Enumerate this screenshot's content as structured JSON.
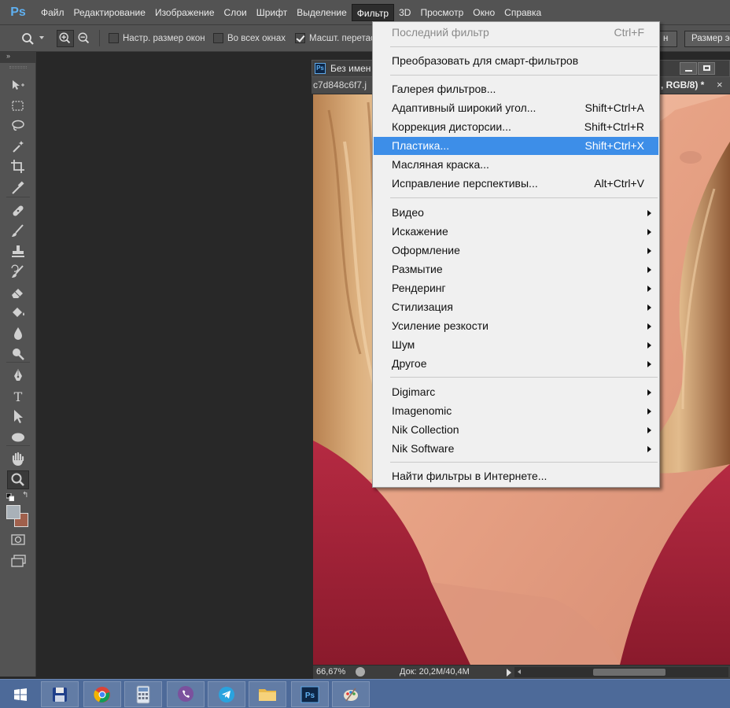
{
  "app": {
    "logo_text": "Ps"
  },
  "menubar": {
    "items": [
      "Файл",
      "Редактирование",
      "Изображение",
      "Слои",
      "Шрифт",
      "Выделение",
      "Фильтр",
      "3D",
      "Просмотр",
      "Окно",
      "Справка"
    ],
    "active_index": 6
  },
  "options": {
    "resize_windows_label": "Настр. размер окон",
    "resize_windows_checked": false,
    "all_windows_label": "Во всех окнах",
    "all_windows_checked": false,
    "scrubby_zoom_label": "Масшт. перетас",
    "scrubby_zoom_checked": true,
    "partial_button_label": "н",
    "screen_size_button_label": "Размер э"
  },
  "document": {
    "title": "Без имен",
    "tab_left": "c7d848c6f7.j",
    "tab_right": ", RGB/8) *",
    "tab_close": "×",
    "zoom": "66,67%",
    "doc_info": "Док: 20,2M/40,4M"
  },
  "filter_menu": {
    "last_filter": {
      "label": "Последний фильтр",
      "shortcut": "Ctrl+F"
    },
    "smart": "Преобразовать для смарт-фильтров",
    "group1": [
      {
        "label": "Галерея фильтров...",
        "shortcut": ""
      },
      {
        "label": "Адаптивный широкий угол...",
        "shortcut": "Shift+Ctrl+A"
      },
      {
        "label": "Коррекция дисторсии...",
        "shortcut": "Shift+Ctrl+R"
      },
      {
        "label": "Пластика...",
        "shortcut": "Shift+Ctrl+X"
      },
      {
        "label": "Масляная краска...",
        "shortcut": ""
      },
      {
        "label": "Исправление перспективы...",
        "shortcut": "Alt+Ctrl+V"
      }
    ],
    "highlighted_index": 3,
    "group2": [
      "Видео",
      "Искажение",
      "Оформление",
      "Размытие",
      "Рендеринг",
      "Стилизация",
      "Усиление резкости",
      "Шум",
      "Другое"
    ],
    "group3": [
      "Digimarc",
      "Imagenomic",
      "Nik Collection",
      "Nik Software"
    ],
    "online": "Найти фильтры в Интернете..."
  },
  "tools": {
    "icons": [
      "move-tool-icon",
      "marquee-tool-icon",
      "lasso-tool-icon",
      "magic-wand-tool-icon",
      "crop-tool-icon",
      "eyedropper-tool-icon",
      "healing-brush-tool-icon",
      "brush-tool-icon",
      "clone-stamp-tool-icon",
      "history-brush-tool-icon",
      "eraser-tool-icon",
      "paint-bucket-tool-icon",
      "blur-tool-icon",
      "dodge-tool-icon",
      "pen-tool-icon",
      "type-tool-icon",
      "path-selection-tool-icon",
      "ellipse-tool-icon",
      "hand-tool-icon",
      "zoom-tool-icon"
    ],
    "selected": "zoom-tool-icon",
    "foreground_color": "#a9b1b8",
    "background_color": "#a0604c"
  },
  "taskbar": {
    "apps": [
      "start-button-icon",
      "floppy-save-icon",
      "chrome-icon",
      "calculator-icon",
      "viber-icon",
      "telegram-icon",
      "folder-icon",
      "photoshop-icon",
      "paint-icon"
    ]
  },
  "colors": {
    "accent": "#3d8ee8",
    "panel": "#535353",
    "workspace": "#282828",
    "taskbar": "#4d6a99",
    "shirt": "#a4243b",
    "skin": "#e3a084"
  }
}
